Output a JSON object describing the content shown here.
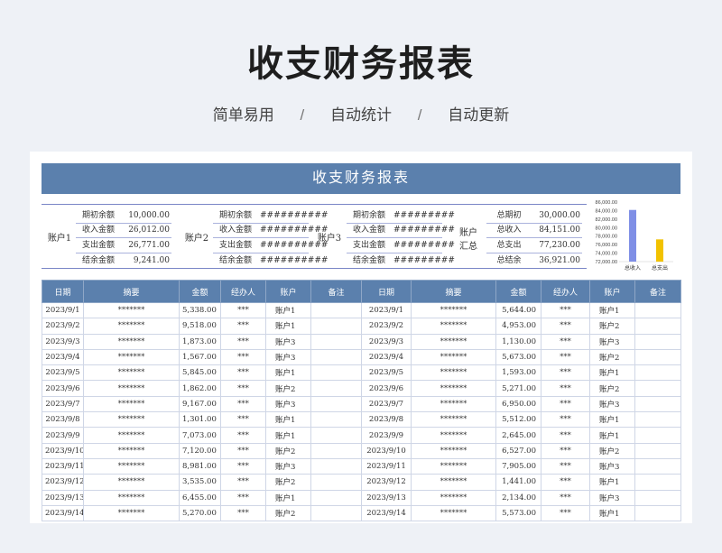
{
  "header": {
    "title": "收支财务报表",
    "tags": [
      "简单易用",
      "自动统计",
      "自动更新"
    ],
    "separator": "/"
  },
  "sheet": {
    "banner": "收支财务报表",
    "accounts": [
      {
        "name": "账户1",
        "rows": [
          {
            "label": "期初余额",
            "value": "10,000.00"
          },
          {
            "label": "收入金额",
            "value": "26,012.00"
          },
          {
            "label": "支出金额",
            "value": "26,771.00"
          },
          {
            "label": "结余金额",
            "value": "9,241.00"
          }
        ]
      },
      {
        "name": "账户2",
        "rows": [
          {
            "label": "期初余额",
            "value": "##########"
          },
          {
            "label": "收入金额",
            "value": "##########"
          },
          {
            "label": "支出金额",
            "value": "##########"
          },
          {
            "label": "结余金额",
            "value": "##########"
          }
        ]
      },
      {
        "name": "账户3",
        "rows": [
          {
            "label": "期初余额",
            "value": "#########"
          },
          {
            "label": "收入金额",
            "value": "#########"
          },
          {
            "label": "支出金额",
            "value": "#########"
          },
          {
            "label": "结余金额",
            "value": "#########"
          }
        ]
      },
      {
        "name": "账户汇总",
        "name_line1": "账户",
        "name_line2": "汇总",
        "rows": [
          {
            "label": "总期初",
            "value": "30,000.00"
          },
          {
            "label": "总收入",
            "value": "84,151.00"
          },
          {
            "label": "总支出",
            "value": "77,230.00"
          },
          {
            "label": "总结余",
            "value": "36,921.00"
          }
        ]
      }
    ],
    "columns": [
      "日期",
      "摘要",
      "金额",
      "经办人",
      "账户",
      "备注",
      "日期",
      "摘要",
      "金额",
      "经办人",
      "账户",
      "备注"
    ],
    "left_rows": [
      [
        "2023/9/1",
        "*******",
        "5,338.00",
        "***",
        "账户1",
        ""
      ],
      [
        "2023/9/2",
        "*******",
        "9,518.00",
        "***",
        "账户1",
        ""
      ],
      [
        "2023/9/3",
        "*******",
        "1,873.00",
        "***",
        "账户3",
        ""
      ],
      [
        "2023/9/4",
        "*******",
        "1,567.00",
        "***",
        "账户3",
        ""
      ],
      [
        "2023/9/5",
        "*******",
        "5,845.00",
        "***",
        "账户1",
        ""
      ],
      [
        "2023/9/6",
        "*******",
        "1,862.00",
        "***",
        "账户2",
        ""
      ],
      [
        "2023/9/7",
        "*******",
        "9,167.00",
        "***",
        "账户3",
        ""
      ],
      [
        "2023/9/8",
        "*******",
        "1,301.00",
        "***",
        "账户1",
        ""
      ],
      [
        "2023/9/9",
        "*******",
        "7,073.00",
        "***",
        "账户1",
        ""
      ],
      [
        "2023/9/10",
        "*******",
        "7,120.00",
        "***",
        "账户2",
        ""
      ],
      [
        "2023/9/11",
        "*******",
        "8,981.00",
        "***",
        "账户3",
        ""
      ],
      [
        "2023/9/12",
        "*******",
        "3,535.00",
        "***",
        "账户2",
        ""
      ],
      [
        "2023/9/13",
        "*******",
        "6,455.00",
        "***",
        "账户1",
        ""
      ],
      [
        "2023/9/14",
        "*******",
        "5,270.00",
        "***",
        "账户2",
        ""
      ]
    ],
    "right_rows": [
      [
        "2023/9/1",
        "*******",
        "5,644.00",
        "***",
        "账户1",
        ""
      ],
      [
        "2023/9/2",
        "*******",
        "4,953.00",
        "***",
        "账户2",
        ""
      ],
      [
        "2023/9/3",
        "*******",
        "1,130.00",
        "***",
        "账户3",
        ""
      ],
      [
        "2023/9/4",
        "*******",
        "5,673.00",
        "***",
        "账户2",
        ""
      ],
      [
        "2023/9/5",
        "*******",
        "1,593.00",
        "***",
        "账户1",
        ""
      ],
      [
        "2023/9/6",
        "*******",
        "5,271.00",
        "***",
        "账户2",
        ""
      ],
      [
        "2023/9/7",
        "*******",
        "6,950.00",
        "***",
        "账户3",
        ""
      ],
      [
        "2023/9/8",
        "*******",
        "5,512.00",
        "***",
        "账户1",
        ""
      ],
      [
        "2023/9/9",
        "*******",
        "2,645.00",
        "***",
        "账户1",
        ""
      ],
      [
        "2023/9/10",
        "*******",
        "6,527.00",
        "***",
        "账户2",
        ""
      ],
      [
        "2023/9/11",
        "*******",
        "7,905.00",
        "***",
        "账户3",
        ""
      ],
      [
        "2023/9/12",
        "*******",
        "1,441.00",
        "***",
        "账户1",
        ""
      ],
      [
        "2023/9/13",
        "*******",
        "2,134.00",
        "***",
        "账户3",
        ""
      ],
      [
        "2023/9/14",
        "*******",
        "5,573.00",
        "***",
        "账户1",
        ""
      ]
    ]
  },
  "chart_data": {
    "type": "bar",
    "categories": [
      "总收入",
      "总支出"
    ],
    "values": [
      84151,
      77230
    ],
    "colors": [
      "#7f8fe6",
      "#f2c200"
    ],
    "ylim": [
      72000,
      86000
    ],
    "yticks": [
      "86,000.00",
      "84,000.00",
      "82,000.00",
      "80,000.00",
      "78,000.00",
      "76,000.00",
      "74,000.00",
      "72,000.00"
    ],
    "grid": false,
    "title": "",
    "xlabel": "",
    "ylabel": ""
  }
}
